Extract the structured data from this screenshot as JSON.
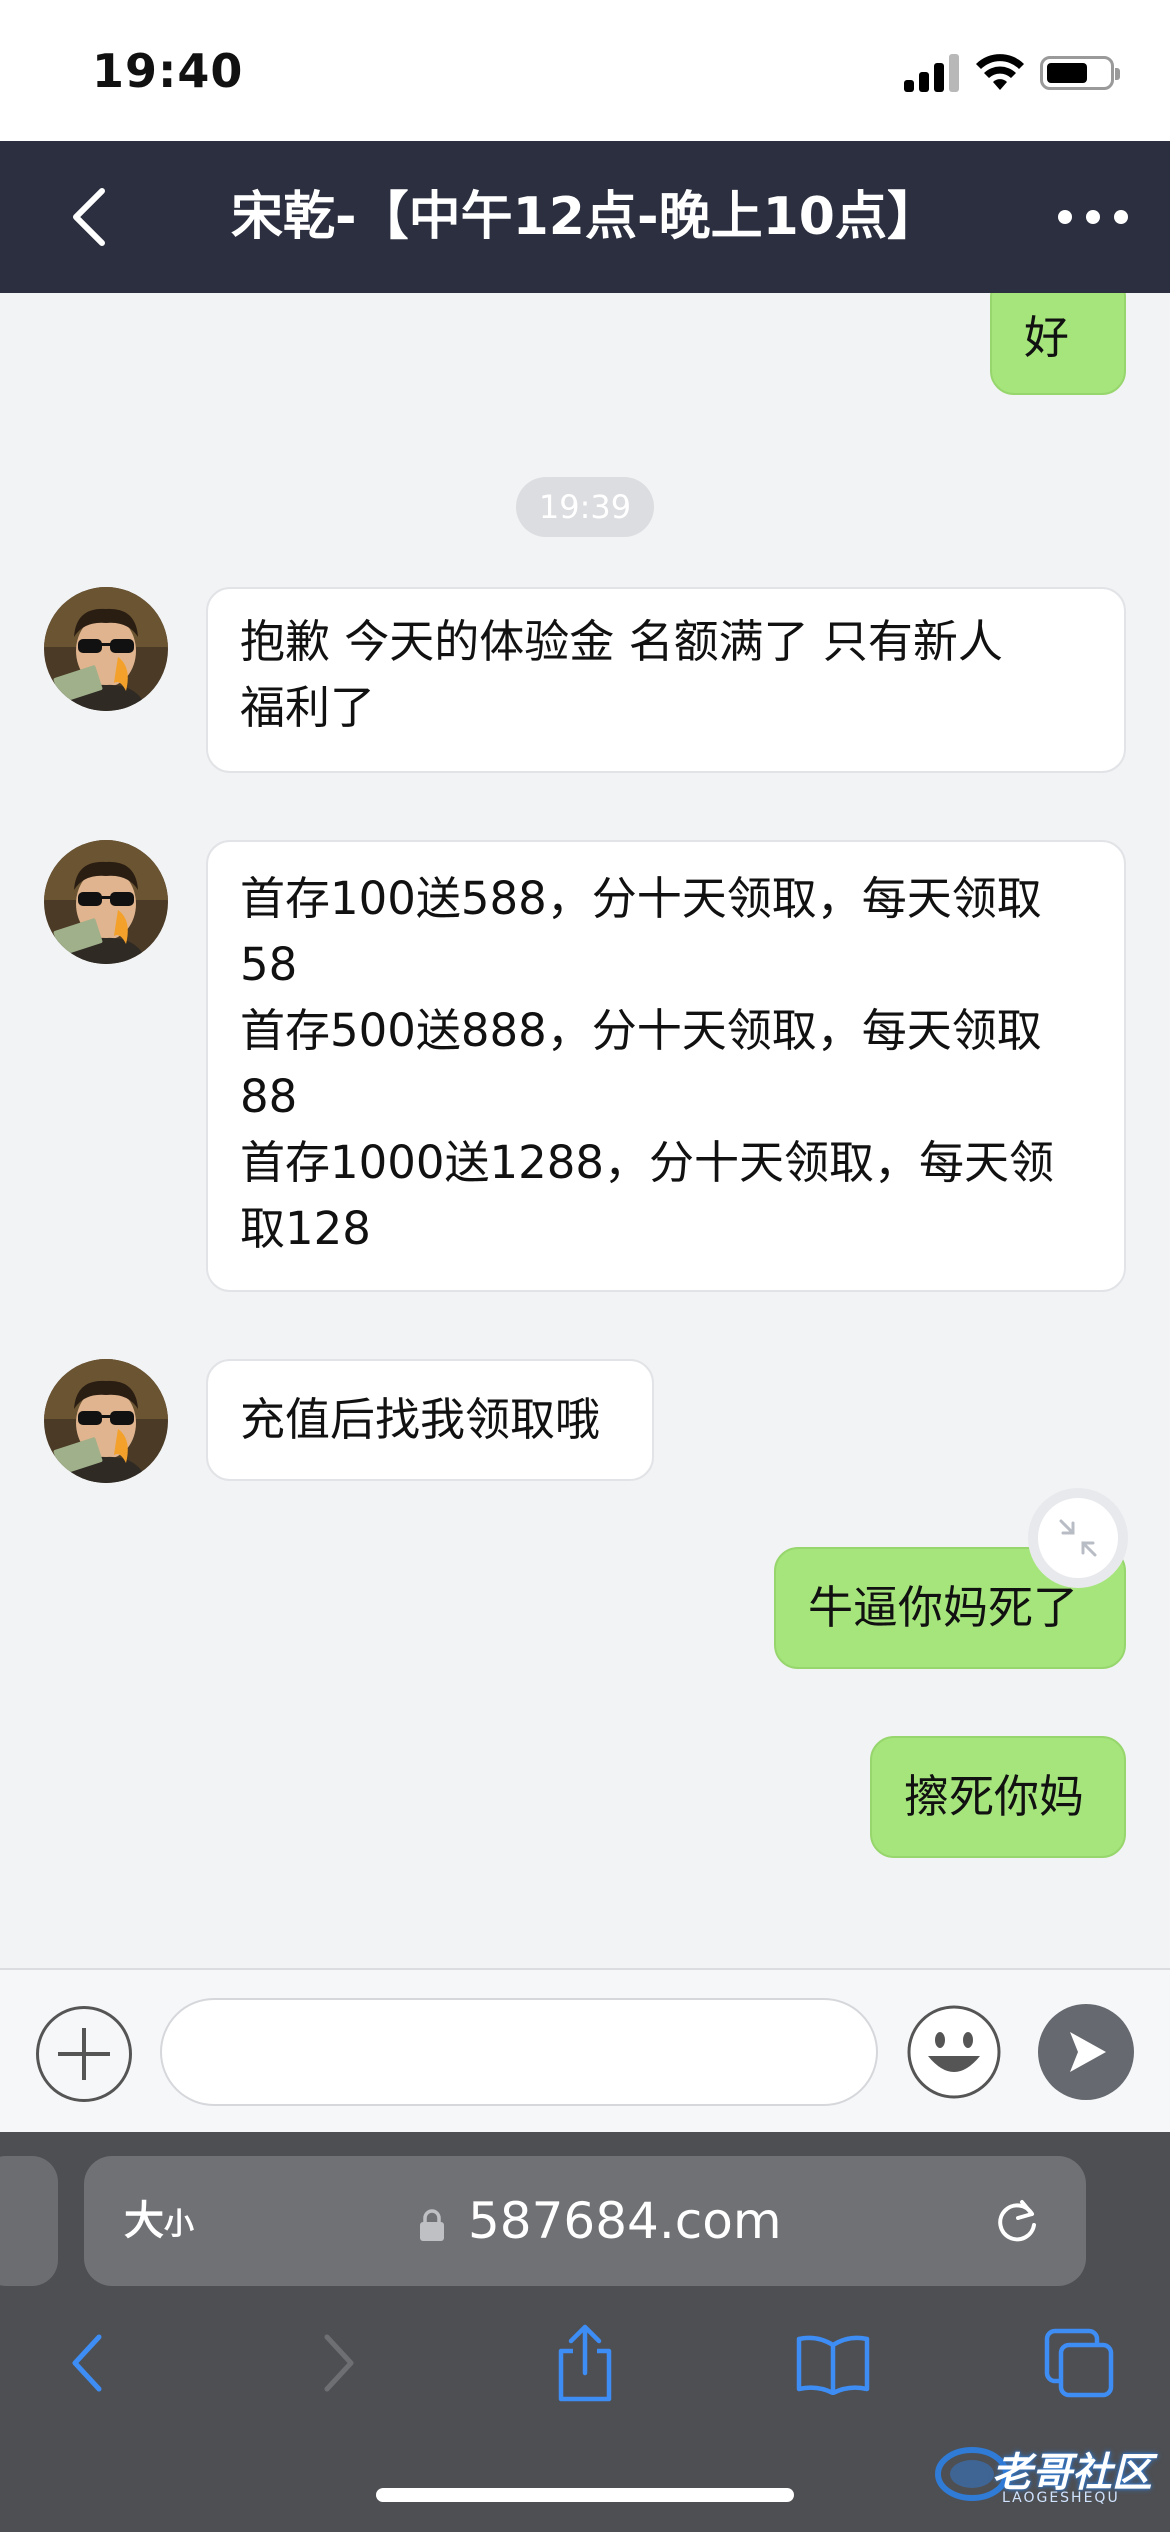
{
  "status_bar": {
    "time": "19:40"
  },
  "header": {
    "title": "宋乾-【中午12点-晚上10点】"
  },
  "messages": {
    "m0": {
      "lines": [
        "好"
      ]
    },
    "timestamp": "19:39",
    "m1": {
      "lines": [
        "抱歉 今天的体验金 名额满了 只有新人",
        "福利了"
      ]
    },
    "m2": {
      "lines": [
        "首存100送588，分十天领取，每天领取",
        "58",
        "首存500送888，分十天领取，每天领取",
        "88",
        "首存1000送1288，分十天领取，每天领",
        "取128"
      ]
    },
    "m3": {
      "lines": [
        "充值后找我领取哦"
      ]
    },
    "m4": {
      "lines": [
        "牛逼你妈死了"
      ]
    },
    "m5": {
      "lines": [
        "擦死你妈"
      ]
    }
  },
  "composer": {
    "input_value": ""
  },
  "browser": {
    "aa_big": "大",
    "aa_small": "小",
    "url": "587684.com"
  },
  "watermark": {
    "text": "老哥社区",
    "sub": "LAOGESHEQU"
  },
  "colors": {
    "header_bg": "#2b2f3f",
    "outgoing_bubble": "#a6e57c",
    "incoming_bubble": "#ffffff",
    "safari_accent": "#3d8df5"
  }
}
